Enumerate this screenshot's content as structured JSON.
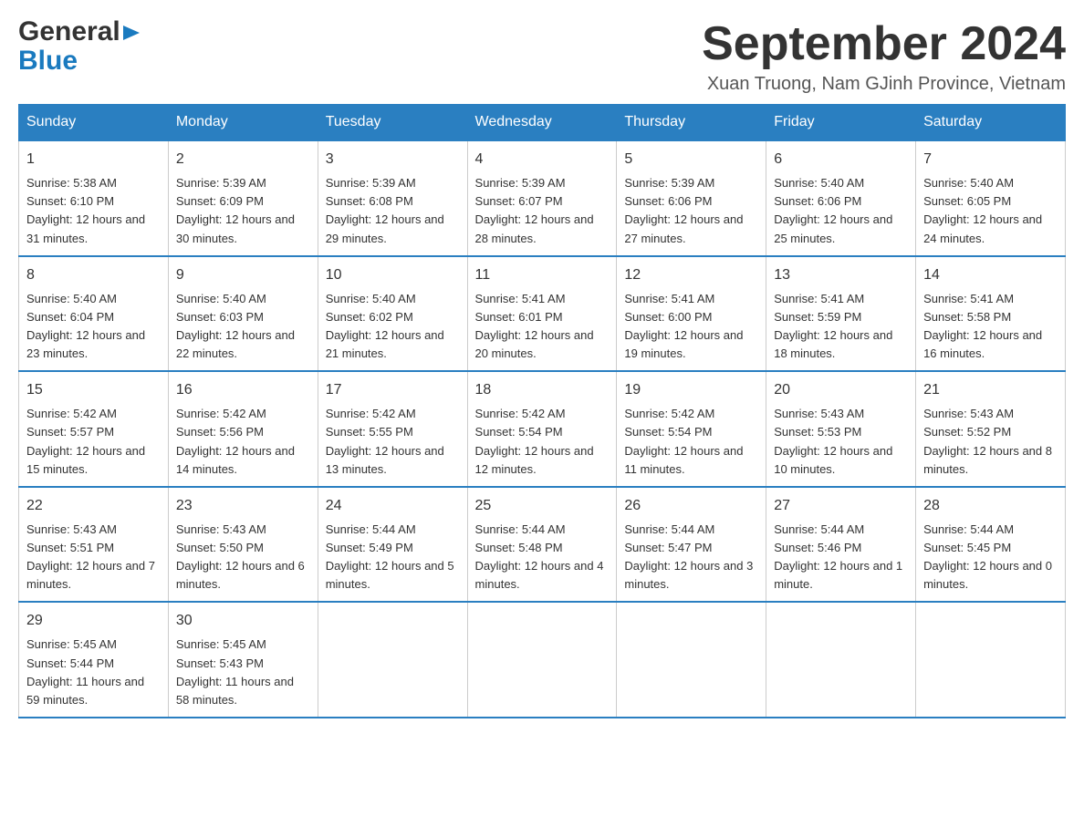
{
  "logo": {
    "general": "General",
    "blue": "Blue"
  },
  "title": "September 2024",
  "location": "Xuan Truong, Nam GJinh Province, Vietnam",
  "days_of_week": [
    "Sunday",
    "Monday",
    "Tuesday",
    "Wednesday",
    "Thursday",
    "Friday",
    "Saturday"
  ],
  "weeks": [
    [
      {
        "day": "1",
        "sunrise": "Sunrise: 5:38 AM",
        "sunset": "Sunset: 6:10 PM",
        "daylight": "Daylight: 12 hours and 31 minutes."
      },
      {
        "day": "2",
        "sunrise": "Sunrise: 5:39 AM",
        "sunset": "Sunset: 6:09 PM",
        "daylight": "Daylight: 12 hours and 30 minutes."
      },
      {
        "day": "3",
        "sunrise": "Sunrise: 5:39 AM",
        "sunset": "Sunset: 6:08 PM",
        "daylight": "Daylight: 12 hours and 29 minutes."
      },
      {
        "day": "4",
        "sunrise": "Sunrise: 5:39 AM",
        "sunset": "Sunset: 6:07 PM",
        "daylight": "Daylight: 12 hours and 28 minutes."
      },
      {
        "day": "5",
        "sunrise": "Sunrise: 5:39 AM",
        "sunset": "Sunset: 6:06 PM",
        "daylight": "Daylight: 12 hours and 27 minutes."
      },
      {
        "day": "6",
        "sunrise": "Sunrise: 5:40 AM",
        "sunset": "Sunset: 6:06 PM",
        "daylight": "Daylight: 12 hours and 25 minutes."
      },
      {
        "day": "7",
        "sunrise": "Sunrise: 5:40 AM",
        "sunset": "Sunset: 6:05 PM",
        "daylight": "Daylight: 12 hours and 24 minutes."
      }
    ],
    [
      {
        "day": "8",
        "sunrise": "Sunrise: 5:40 AM",
        "sunset": "Sunset: 6:04 PM",
        "daylight": "Daylight: 12 hours and 23 minutes."
      },
      {
        "day": "9",
        "sunrise": "Sunrise: 5:40 AM",
        "sunset": "Sunset: 6:03 PM",
        "daylight": "Daylight: 12 hours and 22 minutes."
      },
      {
        "day": "10",
        "sunrise": "Sunrise: 5:40 AM",
        "sunset": "Sunset: 6:02 PM",
        "daylight": "Daylight: 12 hours and 21 minutes."
      },
      {
        "day": "11",
        "sunrise": "Sunrise: 5:41 AM",
        "sunset": "Sunset: 6:01 PM",
        "daylight": "Daylight: 12 hours and 20 minutes."
      },
      {
        "day": "12",
        "sunrise": "Sunrise: 5:41 AM",
        "sunset": "Sunset: 6:00 PM",
        "daylight": "Daylight: 12 hours and 19 minutes."
      },
      {
        "day": "13",
        "sunrise": "Sunrise: 5:41 AM",
        "sunset": "Sunset: 5:59 PM",
        "daylight": "Daylight: 12 hours and 18 minutes."
      },
      {
        "day": "14",
        "sunrise": "Sunrise: 5:41 AM",
        "sunset": "Sunset: 5:58 PM",
        "daylight": "Daylight: 12 hours and 16 minutes."
      }
    ],
    [
      {
        "day": "15",
        "sunrise": "Sunrise: 5:42 AM",
        "sunset": "Sunset: 5:57 PM",
        "daylight": "Daylight: 12 hours and 15 minutes."
      },
      {
        "day": "16",
        "sunrise": "Sunrise: 5:42 AM",
        "sunset": "Sunset: 5:56 PM",
        "daylight": "Daylight: 12 hours and 14 minutes."
      },
      {
        "day": "17",
        "sunrise": "Sunrise: 5:42 AM",
        "sunset": "Sunset: 5:55 PM",
        "daylight": "Daylight: 12 hours and 13 minutes."
      },
      {
        "day": "18",
        "sunrise": "Sunrise: 5:42 AM",
        "sunset": "Sunset: 5:54 PM",
        "daylight": "Daylight: 12 hours and 12 minutes."
      },
      {
        "day": "19",
        "sunrise": "Sunrise: 5:42 AM",
        "sunset": "Sunset: 5:54 PM",
        "daylight": "Daylight: 12 hours and 11 minutes."
      },
      {
        "day": "20",
        "sunrise": "Sunrise: 5:43 AM",
        "sunset": "Sunset: 5:53 PM",
        "daylight": "Daylight: 12 hours and 10 minutes."
      },
      {
        "day": "21",
        "sunrise": "Sunrise: 5:43 AM",
        "sunset": "Sunset: 5:52 PM",
        "daylight": "Daylight: 12 hours and 8 minutes."
      }
    ],
    [
      {
        "day": "22",
        "sunrise": "Sunrise: 5:43 AM",
        "sunset": "Sunset: 5:51 PM",
        "daylight": "Daylight: 12 hours and 7 minutes."
      },
      {
        "day": "23",
        "sunrise": "Sunrise: 5:43 AM",
        "sunset": "Sunset: 5:50 PM",
        "daylight": "Daylight: 12 hours and 6 minutes."
      },
      {
        "day": "24",
        "sunrise": "Sunrise: 5:44 AM",
        "sunset": "Sunset: 5:49 PM",
        "daylight": "Daylight: 12 hours and 5 minutes."
      },
      {
        "day": "25",
        "sunrise": "Sunrise: 5:44 AM",
        "sunset": "Sunset: 5:48 PM",
        "daylight": "Daylight: 12 hours and 4 minutes."
      },
      {
        "day": "26",
        "sunrise": "Sunrise: 5:44 AM",
        "sunset": "Sunset: 5:47 PM",
        "daylight": "Daylight: 12 hours and 3 minutes."
      },
      {
        "day": "27",
        "sunrise": "Sunrise: 5:44 AM",
        "sunset": "Sunset: 5:46 PM",
        "daylight": "Daylight: 12 hours and 1 minute."
      },
      {
        "day": "28",
        "sunrise": "Sunrise: 5:44 AM",
        "sunset": "Sunset: 5:45 PM",
        "daylight": "Daylight: 12 hours and 0 minutes."
      }
    ],
    [
      {
        "day": "29",
        "sunrise": "Sunrise: 5:45 AM",
        "sunset": "Sunset: 5:44 PM",
        "daylight": "Daylight: 11 hours and 59 minutes."
      },
      {
        "day": "30",
        "sunrise": "Sunrise: 5:45 AM",
        "sunset": "Sunset: 5:43 PM",
        "daylight": "Daylight: 11 hours and 58 minutes."
      },
      null,
      null,
      null,
      null,
      null
    ]
  ]
}
